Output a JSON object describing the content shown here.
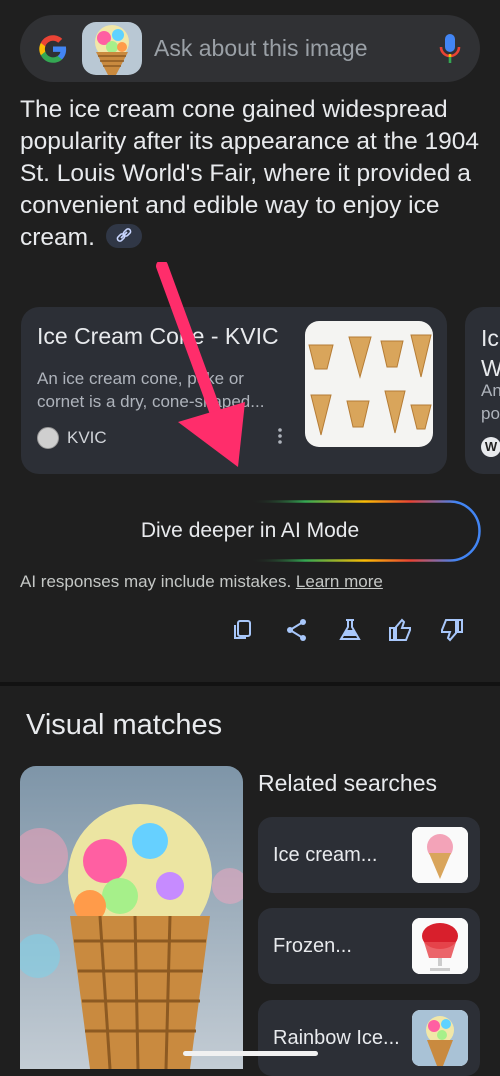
{
  "search": {
    "placeholder": "Ask about this image"
  },
  "answer": {
    "text": "The ice cream cone gained widespread popularity after its appearance at the 1904 St. Louis World's Fair, where it provided a convenient and edible way to enjoy ice cream."
  },
  "cards": [
    {
      "title": "Ice Cream Cone - KVIC",
      "description": "An ice cream cone, poke or cornet is a dry, cone-shaped...",
      "source": "KVIC"
    },
    {
      "title": "Ic W",
      "description": "An po",
      "source_icon": "W"
    }
  ],
  "ai_mode": {
    "label": "Dive deeper in AI Mode"
  },
  "disclaimer": {
    "text": "AI responses may include mistakes.",
    "link": "Learn more"
  },
  "actions": [
    "copy-icon",
    "share-icon",
    "flask-icon",
    "thumbs-up-icon",
    "thumbs-down-icon"
  ],
  "visual_matches": {
    "title": "Visual matches"
  },
  "related": {
    "title": "Related searches",
    "items": [
      {
        "label": "Ice cream..."
      },
      {
        "label": "Frozen..."
      },
      {
        "label": "Rainbow Ice..."
      }
    ]
  },
  "colors": {
    "background": "#1f1f1f",
    "card": "#2c2f36",
    "arrow": "#ff2d6b",
    "link_chip": "#303746"
  }
}
